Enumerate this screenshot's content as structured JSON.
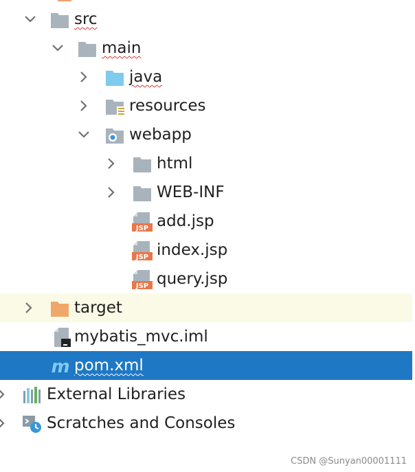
{
  "tree": {
    "items": [
      {
        "label": "src",
        "expanded": true,
        "icon": "folder-icon",
        "spell": true
      },
      {
        "label": "main",
        "expanded": true,
        "icon": "folder-icon",
        "spell": true
      },
      {
        "label": "java",
        "expanded": false,
        "icon": "source-folder-icon",
        "spell": true
      },
      {
        "label": "resources",
        "expanded": false,
        "icon": "resources-folder-icon"
      },
      {
        "label": "webapp",
        "expanded": true,
        "icon": "web-folder-icon"
      },
      {
        "label": "html",
        "expanded": false,
        "icon": "folder-icon"
      },
      {
        "label": "WEB-INF",
        "expanded": false,
        "icon": "folder-icon"
      },
      {
        "label": "add.jsp",
        "icon": "jsp-file-icon"
      },
      {
        "label": "index.jsp",
        "icon": "jsp-file-icon"
      },
      {
        "label": "query.jsp",
        "icon": "jsp-file-icon"
      },
      {
        "label": "target",
        "expanded": false,
        "icon": "excluded-folder-icon",
        "highlighted": true
      },
      {
        "label": "mybatis_mvc.iml",
        "icon": "module-file-icon"
      },
      {
        "label": "pom.xml",
        "icon": "maven-icon",
        "selected": true,
        "spell": true
      },
      {
        "label": "External Libraries",
        "expanded": false,
        "icon": "libraries-icon"
      },
      {
        "label": "Scratches and Consoles",
        "expanded": false,
        "icon": "scratches-icon"
      }
    ],
    "icon_labels": {
      "jsp": "JSP",
      "maven": "m"
    }
  },
  "watermark": "CSDN @Sunyan00001111",
  "colors": {
    "selection": "#1f78c4",
    "highlight": "#fbfae6",
    "folder": "#a9b3bc",
    "target_folder": "#f0a76a",
    "java_folder": "#7fcbee",
    "jsp_badge": "#e8774a"
  }
}
